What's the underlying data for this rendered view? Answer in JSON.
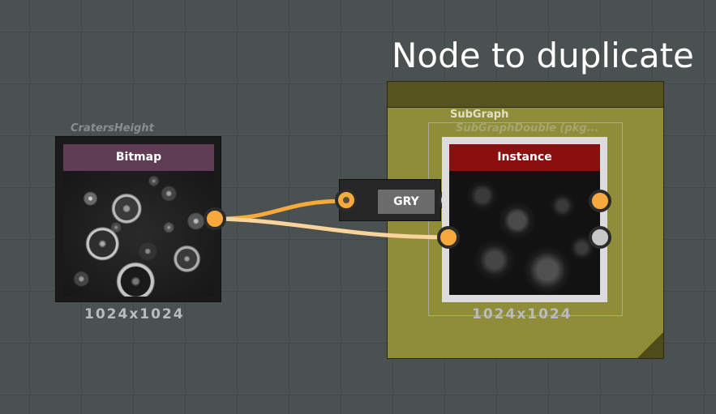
{
  "frame": {
    "title": "Node to duplicate",
    "color": "#8f8d3a",
    "header_color": "#56531f"
  },
  "subgraph": {
    "label": "SubGraph",
    "sublabel": "SubGraphDouble (pkg..."
  },
  "bitmap_node": {
    "caption": "CratersHeight",
    "title": "Bitmap",
    "resolution": "1024x1024",
    "header_color": "#5f3d55"
  },
  "gry_node": {
    "title": "GRY"
  },
  "instance_node": {
    "title": "Instance",
    "resolution": "1024x1024",
    "header_color": "#8a1010"
  },
  "ports": {
    "orange": "#f8a93b",
    "gray": "#c8c8c8"
  },
  "wires": {
    "color_active": "#f8a93b",
    "color_pale": "#fbd39c"
  }
}
